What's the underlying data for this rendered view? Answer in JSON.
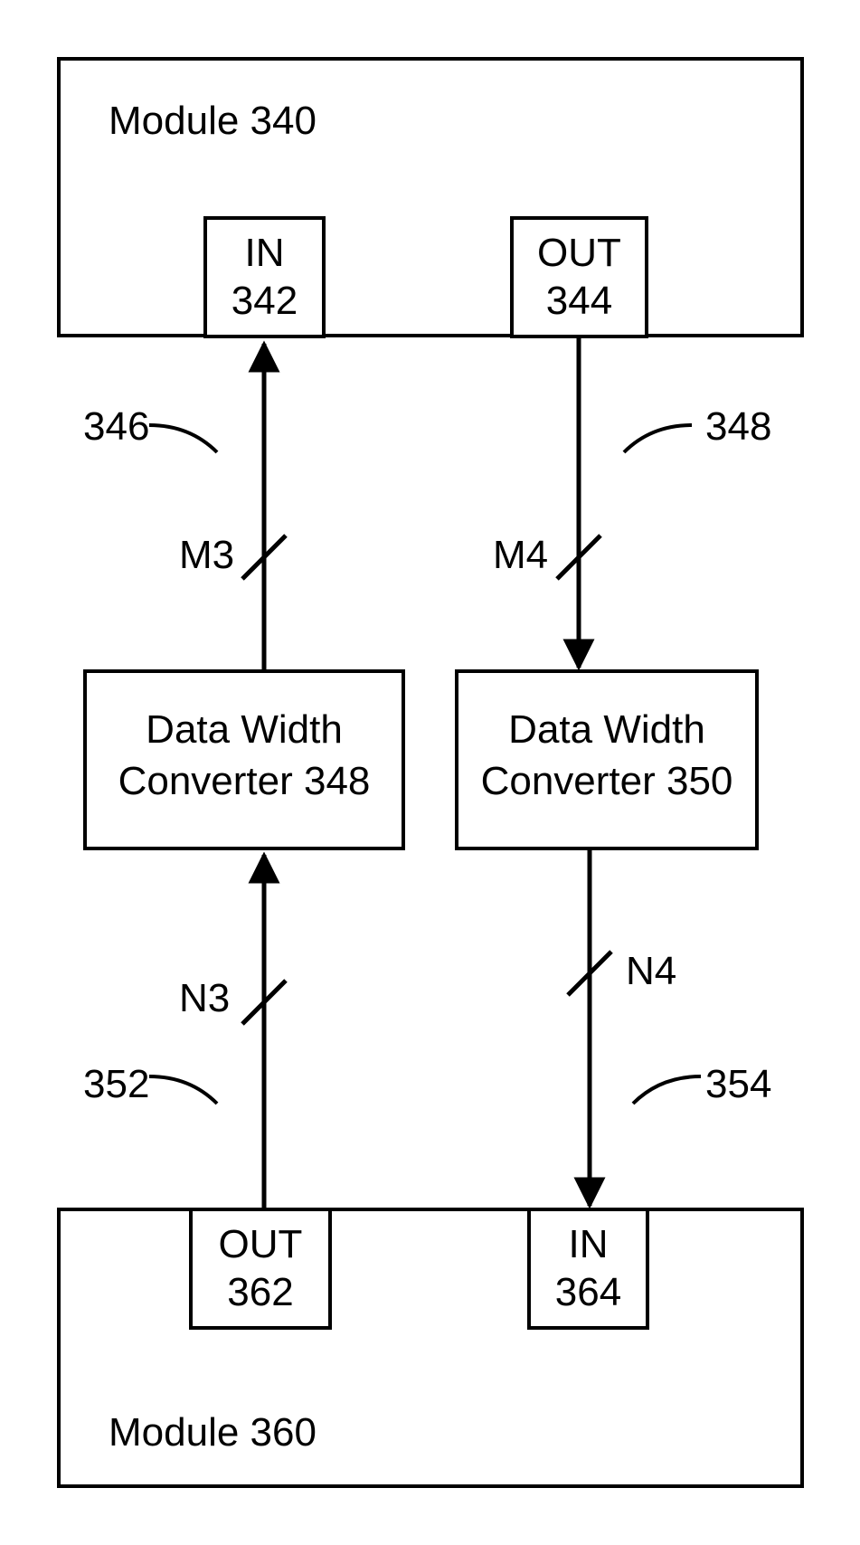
{
  "module_top": {
    "title": "Module 340"
  },
  "module_bottom": {
    "title": "Module 360"
  },
  "ports": {
    "in_top": {
      "l1": "IN",
      "l2": "342"
    },
    "out_top": {
      "l1": "OUT",
      "l2": "344"
    },
    "out_bot": {
      "l1": "OUT",
      "l2": "362"
    },
    "in_bot": {
      "l1": "IN",
      "l2": "364"
    }
  },
  "converters": {
    "left": {
      "l1": "Data Width",
      "l2": "Converter 348"
    },
    "right": {
      "l1": "Data Width",
      "l2": "Converter 350"
    }
  },
  "signals": {
    "ref_346": "346",
    "ref_348": "348",
    "ref_352": "352",
    "ref_354": "354",
    "M3": "M3",
    "M4": "M4",
    "N3": "N3",
    "N4": "N4"
  }
}
